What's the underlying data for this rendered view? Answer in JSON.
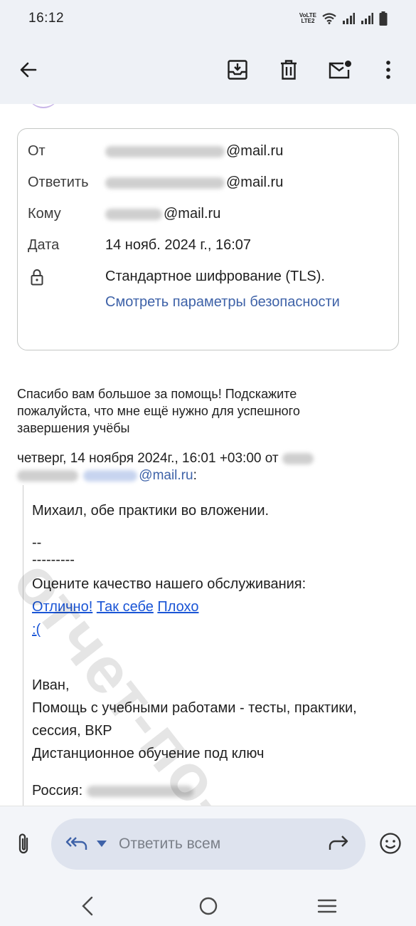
{
  "status_bar": {
    "time": "16:12",
    "network_label_top": "VoLTE",
    "network_label_bottom": "LTE2",
    "icons": [
      "wifi-icon",
      "signal-icon",
      "signal-icon",
      "battery-icon"
    ]
  },
  "app_bar": {
    "icons": [
      "back-arrow-icon",
      "archive-icon",
      "trash-icon",
      "mark-unread-icon",
      "more-vert-icon"
    ]
  },
  "details": {
    "from_label": "От",
    "from_value": "@mail.ru",
    "reply_to_label": "Ответить",
    "reply_to_value": "@mail.ru",
    "to_label": "Кому",
    "to_value": "@mail.ru",
    "date_label": "Дата",
    "date_value": "14 нояб. 2024 г., 16:07",
    "encryption_text": "Стандартное шифрование (TLS).",
    "security_link": "Смотреть параметры безопасности"
  },
  "message": {
    "body_line1": "Спасибо вам большое за помощь!  Подскажите",
    "body_line2": "пожалуйста, что мне ещё нужно для успешного",
    "body_line3": "завершения учёбы",
    "quote_header_line1": "четверг, 14 ноября 2024г., 16:01 +03:00 от",
    "quote_header_email": "@mail.ru",
    "quote_header_colon": ":"
  },
  "quoted": {
    "line1": "Михаил, обе практики во вложении.",
    "sig_dash": "--",
    "separator": "---------",
    "rate_text": "Оцените качество нашего обслуживания:",
    "rate_excellent": "Отлично!",
    "rate_so_so": "Так себе",
    "rate_bad": "Плохо",
    "rate_sad": ":(",
    "name": "Иван,",
    "service_line1": "Помощь с учебными работами - тесты, практики,",
    "service_line2": "сессия, ВКР",
    "service_line3": "Дистанционное обучение под ключ",
    "country_label": "Россия:"
  },
  "watermark": "отчет-по-практике.рф",
  "reply_bar": {
    "placeholder": "Ответить всем"
  },
  "colors": {
    "appbar_bg": "#eef1f6",
    "link_blue": "#3e62a8",
    "quote_link": "#1a55d6",
    "reply_box": "#dee3ee"
  }
}
